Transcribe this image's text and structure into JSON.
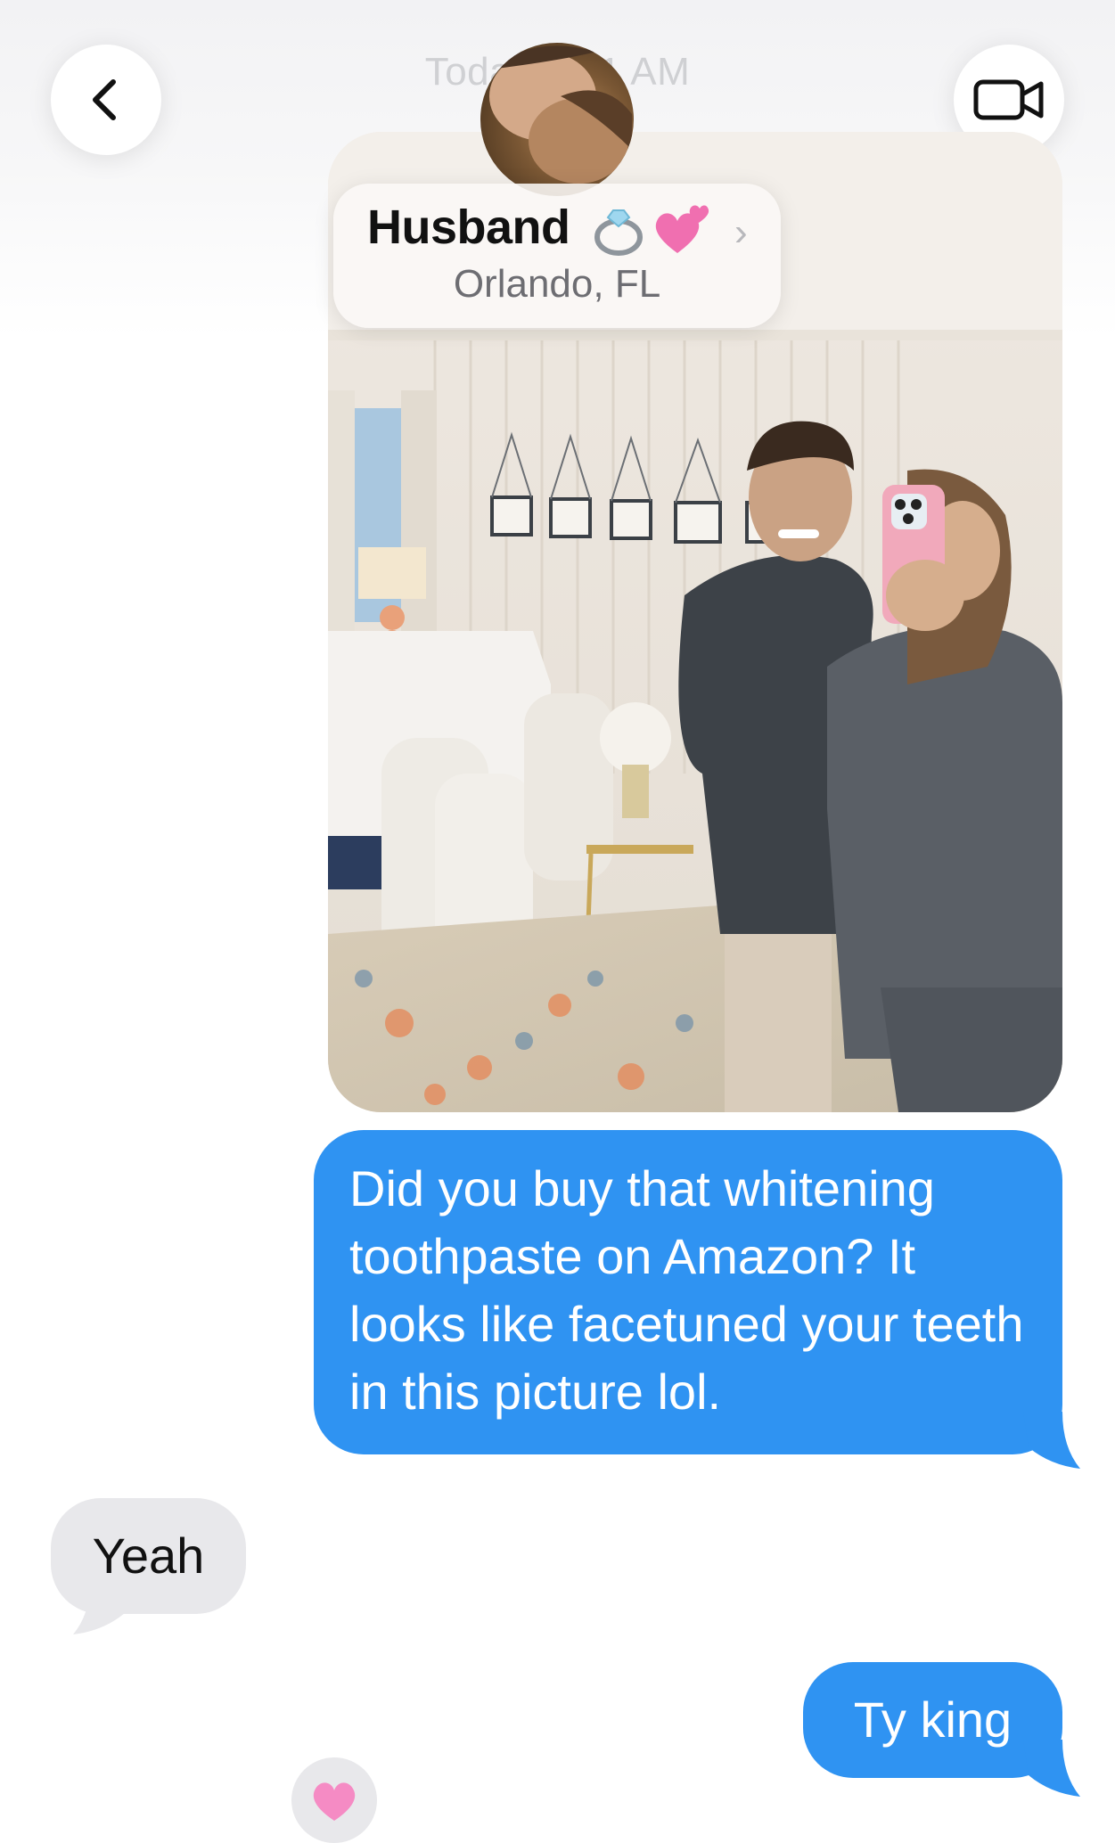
{
  "header": {
    "timestamp": "Today 9:41 AM",
    "back_icon": "chevron-left-icon",
    "video_icon": "video-camera-icon"
  },
  "contact": {
    "name": "Husband",
    "emoji": [
      "ring-icon",
      "two-hearts-icon"
    ],
    "subtitle": "Orlando, FL",
    "chevron": "›"
  },
  "messages": [
    {
      "side": "sent",
      "type": "photo",
      "description_icon": "photo-icon"
    },
    {
      "side": "sent",
      "type": "text",
      "text": "Did you buy that whitening toothpaste on Amazon? It looks like facetuned your teeth in this picture lol."
    },
    {
      "side": "received",
      "type": "text",
      "text": "Yeah"
    },
    {
      "side": "sent",
      "type": "text",
      "text": "Ty king"
    }
  ],
  "reaction": {
    "icon": "pink-heart-icon"
  },
  "colors": {
    "sent_bubble": "#2f93f2",
    "received_bubble": "#e8e8eb",
    "accent_pink": "#f06fb0"
  }
}
